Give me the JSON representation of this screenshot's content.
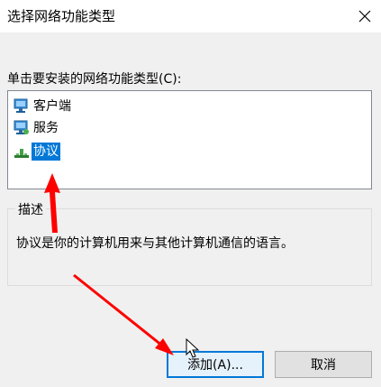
{
  "dialog": {
    "title": "选择网络功能类型",
    "close_label": "×"
  },
  "prompt": "单击要安装的网络功能类型(C):",
  "list": {
    "items": [
      {
        "label": "客户端",
        "icon": "network-computer-icon",
        "selected": false
      },
      {
        "label": "服务",
        "icon": "network-service-icon",
        "selected": false
      },
      {
        "label": "协议",
        "icon": "protocol-icon",
        "selected": true
      }
    ]
  },
  "description": {
    "legend": "描述",
    "text": "协议是你的计算机用来与其他计算机通信的语言。"
  },
  "buttons": {
    "add_label": "添加(A)...",
    "cancel_label": "取消"
  },
  "colors": {
    "selection": "#0078d7",
    "annotation_arrow": "#ff0000",
    "dialog_background": "#f0f0f0"
  }
}
